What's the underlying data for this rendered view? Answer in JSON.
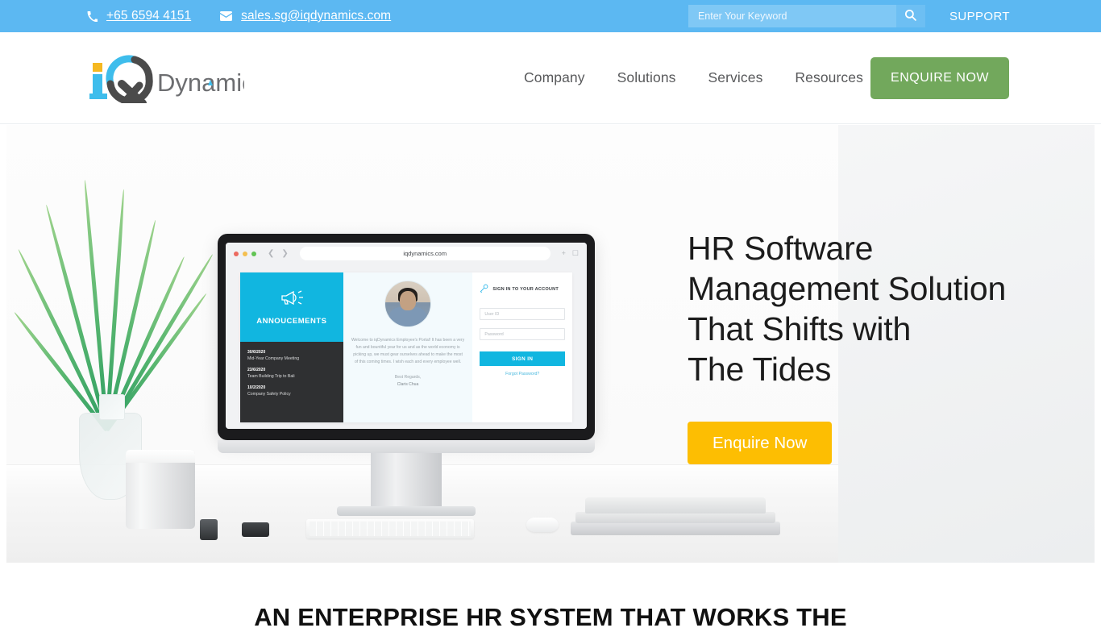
{
  "topbar": {
    "phone": "+65 6594 4151",
    "email": "sales.sg@iqdynamics.com",
    "phone_icon": "phone-icon",
    "email_icon": "envelope-icon",
    "search_placeholder": "Enter Your Keyword",
    "search_value": "",
    "search_icon": "search-icon",
    "support_label": "SUPPORT",
    "bg_color": "#5cb8f2"
  },
  "header": {
    "logo_text": "Dynamics",
    "logo_mark": "iQ",
    "nav": [
      {
        "label": "Company"
      },
      {
        "label": "Solutions"
      },
      {
        "label": "Services"
      },
      {
        "label": "Resources"
      }
    ],
    "enquire_label": "ENQUIRE NOW",
    "enquire_color": "#72a85c"
  },
  "hero": {
    "title_line1": "HR Software Management Solution That Shifts with",
    "title_line2": "The Tides",
    "cta_label": "Enquire Now",
    "cta_color": "#fdbe02"
  },
  "screen": {
    "browser_url": "iqdynamics.com",
    "announcements_title": "ANNOUCEMENTS",
    "megaphone_icon": "megaphone-icon",
    "announcements": [
      {
        "date": "30/6/2020",
        "label": "Mid-Year Company Meeting"
      },
      {
        "date": "23/6/2020",
        "label": "Team Building Trip to Bali"
      },
      {
        "date": "10/2/2020",
        "label": "Company Safety Policy"
      }
    ],
    "welcome_text": "Welcome to iqDynamics Employee's Portal! It has been a very fun and bountiful year for us and as the world economy is picking up, we must gear ourselves ahead to make the most of this coming times. I wish each and every employee well.",
    "regards_label": "Best Regards,",
    "regards_name": "Claris Chua",
    "signin_title": "SIGN IN TO YOUR ACCOUNT",
    "key_icon": "key-icon",
    "userid_placeholder": "User ID",
    "password_placeholder": "Password",
    "signin_button": "SIGN IN",
    "forgot_label": "Forgot Password?",
    "accent_color": "#11b6e0"
  },
  "section": {
    "heading": "AN ENTERPRISE HR SYSTEM THAT WORKS THE"
  }
}
